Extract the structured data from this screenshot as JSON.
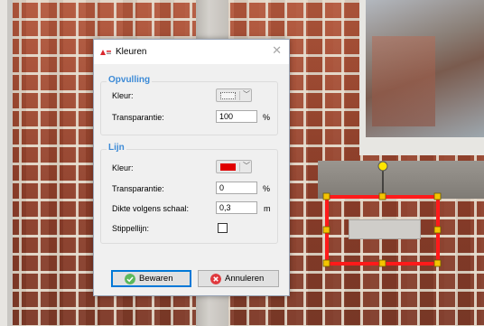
{
  "dialog": {
    "title": "Kleuren",
    "close_label": "✕"
  },
  "fill": {
    "legend": "Opvulling",
    "color_label": "Kleur:",
    "transparency_label": "Transparantie:",
    "transparency_value": "100",
    "transparency_unit": "%"
  },
  "line": {
    "legend": "Lijn",
    "color_label": "Kleur:",
    "color": "#e00000",
    "transparency_label": "Transparantie:",
    "transparency_value": "0",
    "transparency_unit": "%",
    "thickness_label": "Dikte volgens schaal:",
    "thickness_value": "0,3",
    "thickness_unit": "m",
    "dashed_label": "Stippellijn:",
    "dashed_checked": false
  },
  "buttons": {
    "save_label": "Bewaren",
    "cancel_label": "Annuleren"
  },
  "colors": {
    "accent": "#0078d7",
    "group_title": "#3c8ad6",
    "selection": "#ff1a1a",
    "handle": "#f5c400"
  }
}
